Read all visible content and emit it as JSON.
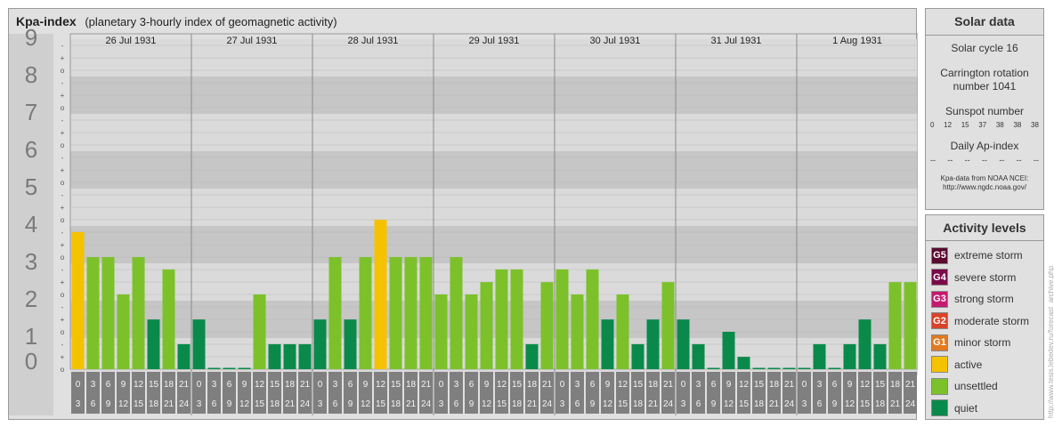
{
  "header": {
    "title": "Kpa-index",
    "subtitle": "(planetary 3-hourly index of geomagnetic activity)"
  },
  "chart_data": {
    "type": "bar",
    "y_axis": {
      "levels": [
        "0",
        "1",
        "2",
        "3",
        "4",
        "5",
        "6",
        "7",
        "8",
        "9"
      ],
      "sub_marks": [
        "o",
        "+",
        "-"
      ],
      "ylim": [
        0,
        9.33
      ]
    },
    "days": [
      "26 Jul 1931",
      "27 Jul 1931",
      "28 Jul 1931",
      "29 Jul 1931",
      "30 Jul 1931",
      "31 Jul 1931",
      "1 Aug 1931"
    ],
    "interval_labels": [
      [
        "0",
        "3"
      ],
      [
        "3",
        "6"
      ],
      [
        "6",
        "9"
      ],
      [
        "9",
        "12"
      ],
      [
        "12",
        "15"
      ],
      [
        "15",
        "18"
      ],
      [
        "18",
        "21"
      ],
      [
        "21",
        "24"
      ]
    ],
    "values": [
      [
        3.67,
        3,
        3,
        2,
        3,
        1.33,
        2.67,
        0.67
      ],
      [
        1.33,
        0,
        0,
        0,
        2,
        0.67,
        0.67,
        0.67
      ],
      [
        1.33,
        3,
        1.33,
        3,
        4,
        3,
        3,
        3
      ],
      [
        2,
        3,
        2,
        2.33,
        2.67,
        2.67,
        0.67,
        2.33
      ],
      [
        2.67,
        2,
        2.67,
        1.33,
        2,
        0.67,
        1.33,
        2.33
      ],
      [
        1.33,
        0.67,
        0,
        1,
        0.33,
        0,
        0,
        0
      ],
      [
        0,
        0.67,
        0,
        0.67,
        1.33,
        0.67,
        2.33,
        2.33
      ]
    ],
    "colors": {
      "quiet": "#0a8a4a",
      "unsettled": "#7cc12a",
      "active": "#f5c200"
    }
  },
  "solar": {
    "title": "Solar data",
    "cycle": "Solar cycle 16",
    "carrington": [
      "Carrington rotation",
      "number 1041"
    ],
    "sunspot_label": "Sunspot number",
    "sunspot_values": [
      "0",
      "12",
      "15",
      "37",
      "38",
      "38",
      "38"
    ],
    "ap_label": "Daily Ap-index",
    "ap_values": [
      "--",
      "--",
      "--",
      "--",
      "--",
      "--",
      "--"
    ],
    "credit": [
      "Kpa-data from NOAA NCEI:",
      "http://www.ngdc.noaa.gov/"
    ]
  },
  "activity": {
    "title": "Activity levels",
    "items": [
      {
        "badge": "G5",
        "label": "extreme storm",
        "color": "#5a0a2e"
      },
      {
        "badge": "G4",
        "label": "severe storm",
        "color": "#7a0a4a"
      },
      {
        "badge": "G3",
        "label": "strong storm",
        "color": "#c41a6e"
      },
      {
        "badge": "G2",
        "label": "moderate storm",
        "color": "#d8442a"
      },
      {
        "badge": "G1",
        "label": "minor storm",
        "color": "#e07b22"
      },
      {
        "badge": "",
        "label": "active",
        "color": "#f5c200"
      },
      {
        "badge": "",
        "label": "unsettled",
        "color": "#7cc12a"
      },
      {
        "badge": "",
        "label": "quiet",
        "color": "#0a8a4a"
      }
    ]
  },
  "watermark": "http://www.tesis.lebedev.ru/forecast_archive.php"
}
